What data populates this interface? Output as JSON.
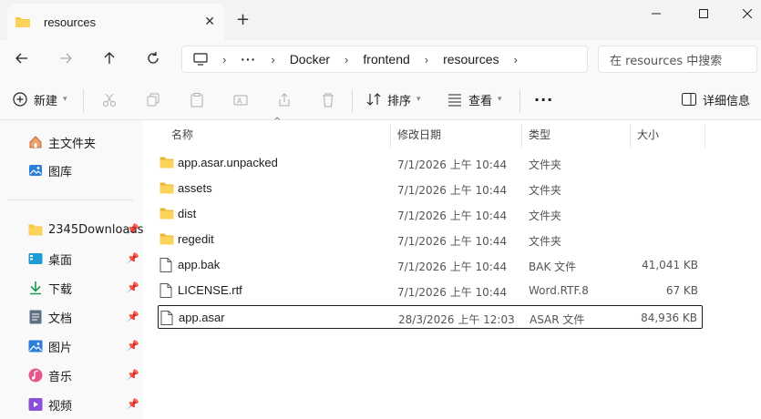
{
  "tab": {
    "title": "resources"
  },
  "address": {
    "crumbs": [
      "Docker",
      "frontend",
      "resources"
    ],
    "ellipsis": "···",
    "search_placeholder": "在 resources 中搜索"
  },
  "command_bar": {
    "new_label": "新建",
    "sort_label": "排序",
    "view_label": "查看",
    "more_label": "···",
    "details_label": "详细信息"
  },
  "sidebar": {
    "items": [
      {
        "label": "主文件夹",
        "icon": "home-icon",
        "pinned": false
      },
      {
        "label": "图库",
        "icon": "gallery-icon",
        "pinned": false
      },
      {
        "label": "2345Downloads",
        "icon": "folder-icon",
        "pinned": true
      },
      {
        "label": "桌面",
        "icon": "desktop-icon",
        "pinned": true
      },
      {
        "label": "下载",
        "icon": "download-icon",
        "pinned": true
      },
      {
        "label": "文档",
        "icon": "document-icon",
        "pinned": true
      },
      {
        "label": "图片",
        "icon": "pictures-icon",
        "pinned": true
      },
      {
        "label": "音乐",
        "icon": "music-icon",
        "pinned": true
      },
      {
        "label": "视频",
        "icon": "video-icon",
        "pinned": true
      }
    ]
  },
  "columns": {
    "name": "名称",
    "date": "修改日期",
    "type": "类型",
    "size": "大小"
  },
  "files": [
    {
      "name": "app.asar.unpacked",
      "date": "7/1/2026 上午 10:44",
      "type": "文件夹",
      "size": "",
      "kind": "folder"
    },
    {
      "name": "assets",
      "date": "7/1/2026 上午 10:44",
      "type": "文件夹",
      "size": "",
      "kind": "folder"
    },
    {
      "name": "dist",
      "date": "7/1/2026 上午 10:44",
      "type": "文件夹",
      "size": "",
      "kind": "folder"
    },
    {
      "name": "regedit",
      "date": "7/1/2026 上午 10:44",
      "type": "文件夹",
      "size": "",
      "kind": "folder"
    },
    {
      "name": "app.bak",
      "date": "7/1/2026 上午 10:44",
      "type": "BAK 文件",
      "size": "41,041 KB",
      "kind": "file"
    },
    {
      "name": "LICENSE.rtf",
      "date": "7/1/2026 上午 10:44",
      "type": "Word.RTF.8",
      "size": "67 KB",
      "kind": "file"
    },
    {
      "name": "app.asar",
      "date": "28/3/2026 上午 12:03",
      "type": "ASAR 文件",
      "size": "84,936 KB",
      "kind": "file",
      "selected": true
    }
  ]
}
